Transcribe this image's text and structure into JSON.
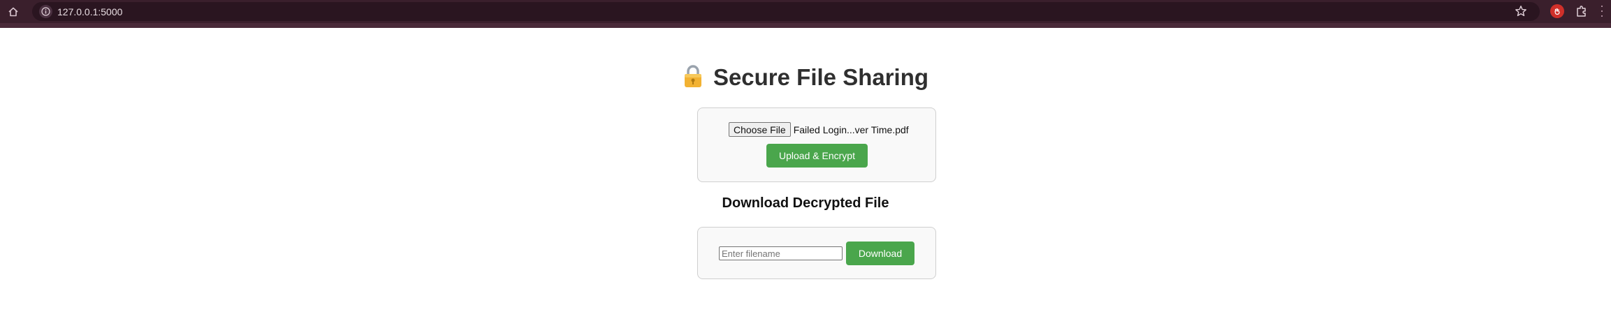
{
  "browser": {
    "url": "127.0.0.1:5000"
  },
  "page": {
    "title": "Secure File Sharing",
    "title_icon": "lock-icon"
  },
  "upload": {
    "choose_file_label": "Choose File",
    "selected_file": "Failed Login...ver Time.pdf",
    "submit_label": "Upload & Encrypt"
  },
  "download": {
    "heading": "Download Decrypted File",
    "filename_placeholder": "Enter filename",
    "filename_value": "",
    "submit_label": "Download"
  },
  "colors": {
    "chrome_bg": "#3a1f2c",
    "accent_green": "#4aa64c",
    "card_bg": "#f9f9f9"
  }
}
